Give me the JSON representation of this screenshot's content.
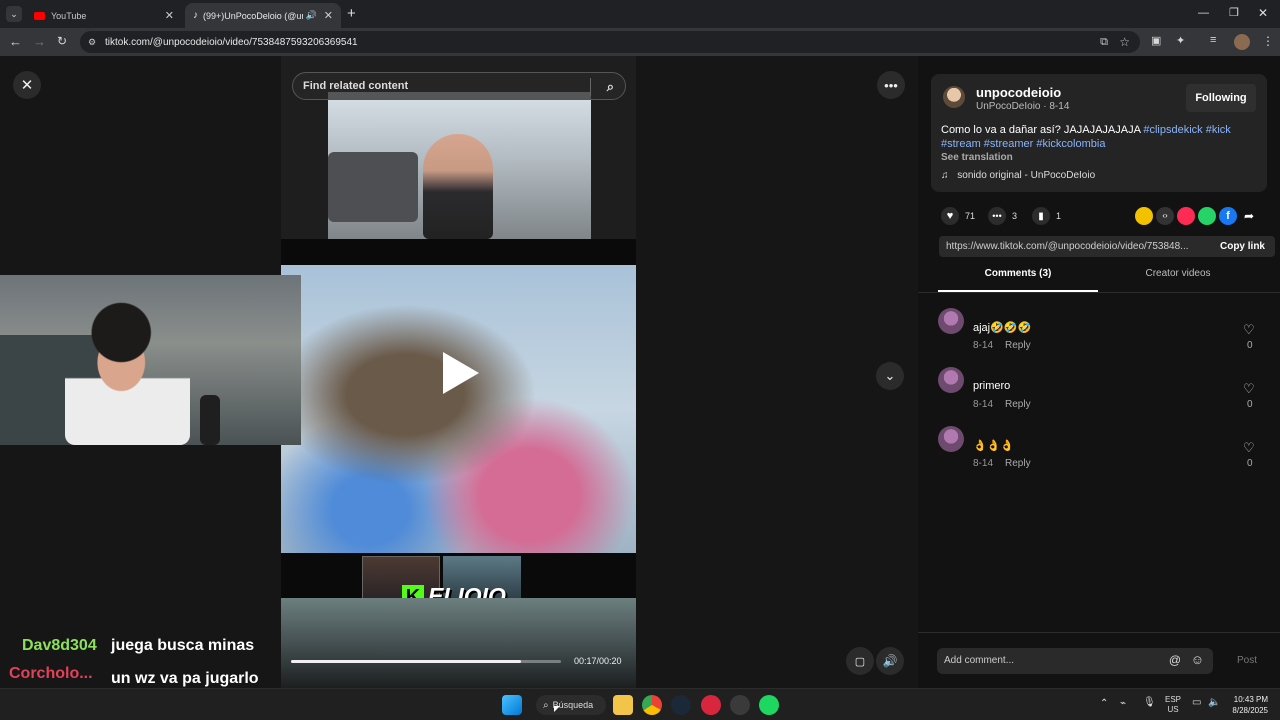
{
  "browser": {
    "tabs": [
      {
        "label": "YouTube"
      },
      {
        "label": "(99+)UnPocoDeloio (@unp"
      }
    ],
    "url": "tiktok.com/@unpocodeioio/video/7538487593206369541"
  },
  "video": {
    "search_placeholder": "Find related content",
    "stream_logo_text": "ELIOIO",
    "time": "00:17/00:20",
    "progress": 0.85
  },
  "chat": [
    {
      "user": "Dav8d304",
      "message": "juega busca minas",
      "color": "#8be15a"
    },
    {
      "user": "Corcholo...",
      "message": "un wz va pa jugarlo entre varios",
      "color": "#e0425a"
    }
  ],
  "post": {
    "username": "unpocodeioio",
    "display": "UnPocoDeIoio · 8-14",
    "follow_label": "Following",
    "caption_text": "Como lo va a dañar así? JAJAJAJAJAJA ",
    "hashtags": "#clipsdekick #kick #stream #streamer #kickcolombia",
    "see_translation": "See translation",
    "sound": "sonido original - UnPocoDeIoio",
    "likes": "71",
    "comments": "3",
    "saves": "1",
    "link": "https://www.tiktok.com/@unpocodeioio/video/753848...",
    "copy_label": "Copy link"
  },
  "tabs": {
    "comments_label": "Comments (3)",
    "creator_label": "Creator videos"
  },
  "comments": [
    {
      "text": "ajaj🤣🤣🤣",
      "date": "8-14",
      "reply": "Reply",
      "likes": "0"
    },
    {
      "text": "primero",
      "date": "8-14",
      "reply": "Reply",
      "likes": "0"
    },
    {
      "text": "👌👌👌",
      "date": "8-14",
      "reply": "Reply",
      "likes": "0"
    }
  ],
  "composer": {
    "placeholder": "Add comment...",
    "post_label": "Post"
  },
  "taskbar": {
    "search_label": "Búsqueda",
    "lang_top": "ESP",
    "lang_bottom": "US",
    "time": "10:43 PM",
    "date": "8/28/2025"
  },
  "colors": {
    "accent_pink": "#fe2c55",
    "hashtag": "#8ab4f8",
    "kick_green": "#53fc18"
  }
}
